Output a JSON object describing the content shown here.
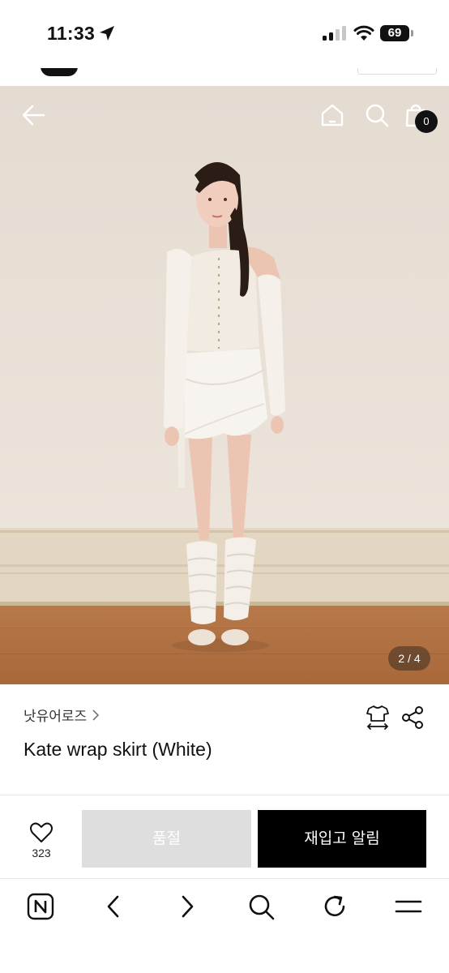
{
  "status_bar": {
    "time": "11:33",
    "battery": "69",
    "battery_level": 0.69
  },
  "header": {
    "cart_count": "0"
  },
  "gallery": {
    "indicator": "2 / 4",
    "current_index": 2,
    "total": 4
  },
  "product": {
    "brand": "낫유어로즈",
    "name": "Kate wrap skirt (White)"
  },
  "purchase_bar": {
    "like_count": "323",
    "soldout_label": "품절",
    "restock_label": "재입고 알림"
  },
  "colors": {
    "accent": "#000000",
    "soldout_bg": "#dedede",
    "wall": "#e9e1d8",
    "floor": "#b0713f"
  },
  "icons": {
    "back": "arrow-left-icon",
    "home": "home-icon",
    "search": "search-icon",
    "cart": "shopping-bag-icon",
    "size": "size-guide-icon",
    "share": "share-icon",
    "like": "heart-icon",
    "browser": [
      "naver-n-icon",
      "chevron-left-icon",
      "chevron-right-icon",
      "search-icon",
      "refresh-icon",
      "menu-icon"
    ]
  }
}
